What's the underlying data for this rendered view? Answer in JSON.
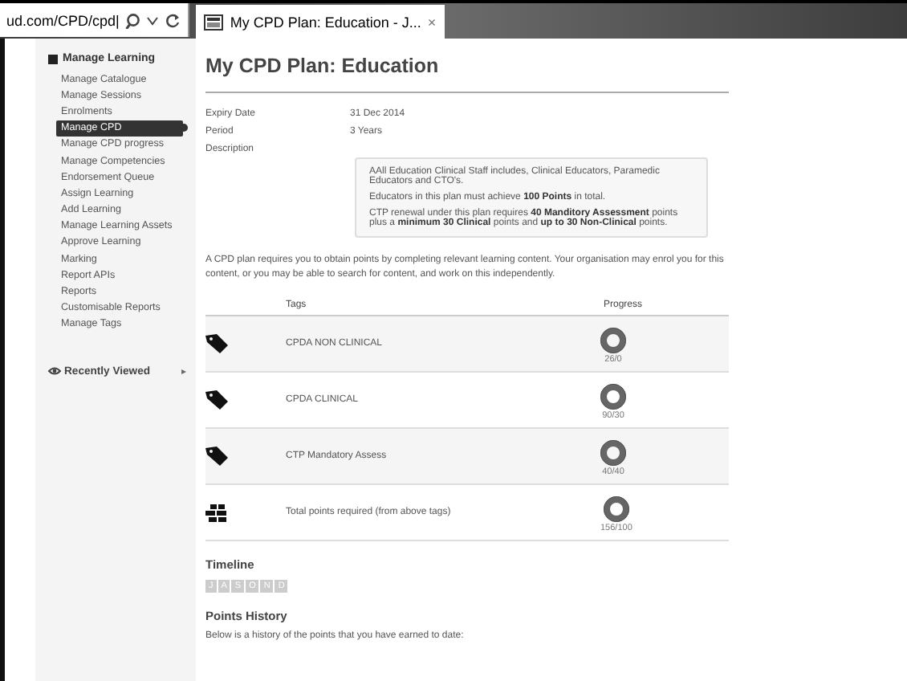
{
  "browser": {
    "address": "ud.com/CPD/cpd|",
    "tab_title": "My CPD Plan: Education - J...",
    "tab_close": "×"
  },
  "sidebar": {
    "heading": "Manage Learning",
    "items": [
      {
        "label": "Manage Catalogue",
        "selected": false
      },
      {
        "label": "Manage Sessions",
        "selected": false
      },
      {
        "label": "Enrolments",
        "selected": false
      },
      {
        "label": "Manage CPD",
        "selected": true
      },
      {
        "label": "Manage CPD progress",
        "selected": false
      },
      {
        "label": "Manage Competencies",
        "selected": false
      },
      {
        "label": "Endorsement Queue",
        "selected": false
      },
      {
        "label": "Assign Learning",
        "selected": false
      },
      {
        "label": "Add Learning",
        "selected": false
      },
      {
        "label": "Manage Learning Assets",
        "selected": false
      },
      {
        "label": "Approve Learning",
        "selected": false
      },
      {
        "label": "Marking",
        "selected": false
      },
      {
        "label": "Report APIs",
        "selected": false
      },
      {
        "label": "Reports",
        "selected": false
      },
      {
        "label": "Customisable Reports",
        "selected": false
      },
      {
        "label": "Manage Tags",
        "selected": false
      }
    ],
    "recent": "Recently Viewed",
    "recent_arrow": "▸"
  },
  "page": {
    "title": "My CPD Plan: Education",
    "fields": [
      {
        "label": "Expiry Date",
        "value": "31 Dec 2014"
      },
      {
        "label": "Period",
        "value": "3 Years"
      },
      {
        "label": "Description"
      }
    ],
    "description": [
      "AAll Education Clinical Staff includes, Clinical Educators, Paramedic Educators and CTO's.",
      "Educators in this plan must achieve **100 Points** in total.",
      "CTP renewal under this plan requires **40 Manditory Assessment** points plus a **minimum 30 Clinical** points and **up to 30 Non-Clinical** points."
    ],
    "intro": "A CPD plan requires you to obtain points by completing relevant learning content. Your organisation may enrol you for this content, or you may be able to search for content, and work on this independently.",
    "table": {
      "columns": [
        "Tags",
        "Progress"
      ],
      "rows": [
        {
          "kind": "tag",
          "name": "CPDA NON CLINICAL",
          "progress": "26/0"
        },
        {
          "kind": "tag",
          "name": "CPDA CLINICAL",
          "progress": "90/30"
        },
        {
          "kind": "tag",
          "name": "CTP Mandatory Assess",
          "progress": "40/40"
        },
        {
          "kind": "total",
          "name": "Total points required (from above tags)",
          "progress": "156/100"
        }
      ]
    },
    "timeline": {
      "heading": "Timeline",
      "months": [
        "J",
        "A",
        "S",
        "O",
        "N",
        "D"
      ]
    },
    "history": {
      "heading": "Points History",
      "text": "Below is a history of the points that you have earned to date:"
    }
  }
}
